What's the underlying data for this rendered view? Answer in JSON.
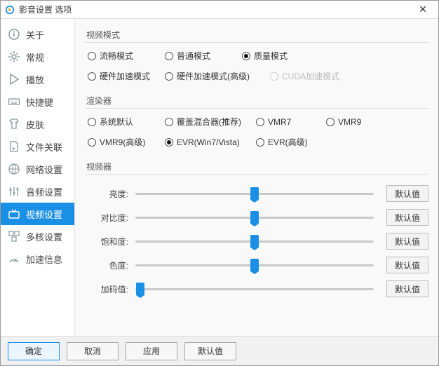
{
  "title": "影音设置 选项",
  "sidebar": [
    {
      "label": "关于"
    },
    {
      "label": "常规"
    },
    {
      "label": "播放"
    },
    {
      "label": "快捷键"
    },
    {
      "label": "皮肤"
    },
    {
      "label": "文件关联"
    },
    {
      "label": "网络设置"
    },
    {
      "label": "音频设置"
    },
    {
      "label": "视频设置"
    },
    {
      "label": "多核设置"
    },
    {
      "label": "加速信息"
    }
  ],
  "video_mode": {
    "title": "视频模式",
    "options": [
      "流畅模式",
      "普通模式",
      "质量模式",
      "硬件加速模式",
      "硬件加速模式(高级)",
      "CUDA加速模式"
    ],
    "selected": "质量模式",
    "disabled": [
      "CUDA加速模式"
    ]
  },
  "renderer": {
    "title": "渲染器",
    "options": [
      "系统默认",
      "覆盖混合器(推荐)",
      "VMR7",
      "VMR9",
      "VMR9(高级)",
      "EVR(Win7/Vista)",
      "EVR(高级)"
    ],
    "selected": "EVR(Win7/Vista)"
  },
  "video_proc": {
    "title": "视频器",
    "sliders": [
      {
        "label": "亮度:",
        "value": 50,
        "min": 0,
        "max": 100
      },
      {
        "label": "对比度:",
        "value": 50,
        "min": 0,
        "max": 100
      },
      {
        "label": "饱和度:",
        "value": 50,
        "min": 0,
        "max": 100
      },
      {
        "label": "色度:",
        "value": 50,
        "min": 0,
        "max": 100
      },
      {
        "label": "加码值:",
        "value": 0,
        "min": 0,
        "max": 100
      }
    ]
  },
  "buttons": {
    "ok": "确定",
    "cancel": "取消",
    "apply": "应用",
    "default": "默认值"
  },
  "colors": {
    "accent": "#1a8fe6"
  }
}
